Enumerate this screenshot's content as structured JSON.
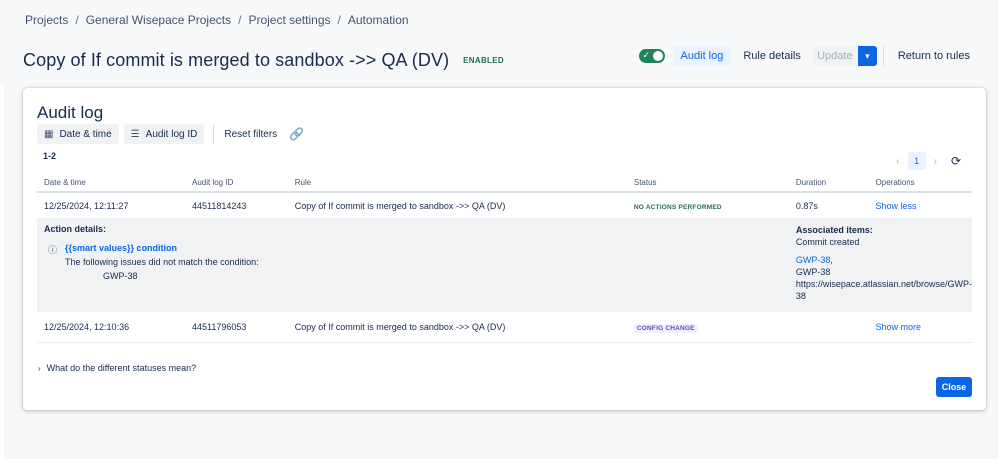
{
  "breadcrumb": [
    "Projects",
    "General Wisepace Projects",
    "Project settings",
    "Automation"
  ],
  "header": {
    "title": "Copy of If commit is merged to sandbox ->> QA (DV)",
    "status_lozenge": "ENABLED",
    "toggle_check": "✓",
    "audit_log_label": "Audit log",
    "rule_details_label": "Rule details",
    "update_label": "Update",
    "dropdown_icon": "▾",
    "return_label": "Return to rules"
  },
  "modal": {
    "title": "Audit log",
    "filters": {
      "date_time_label": "Date & time",
      "audit_id_label": "Audit log ID",
      "reset_label": "Reset filters",
      "calendar_icon": "▦",
      "list_icon": "☰",
      "link_icon": "🔗"
    },
    "count_label": "1-2",
    "pager": {
      "prev": "‹",
      "current_page": "1",
      "next": "›",
      "refresh": "⟳"
    },
    "columns": [
      "Date & time",
      "Audit log ID",
      "Rule",
      "Status",
      "Duration",
      "Operations"
    ],
    "rows": [
      {
        "date": "12/25/2024, 12:11:27",
        "id": "44511814243",
        "rule": "Copy of If commit is merged to sandbox ->> QA (DV)",
        "status": "NO ACTIONS PERFORMED",
        "duration": "0.87s",
        "operation": "Show less"
      },
      {
        "date": "12/25/2024, 12:10:36",
        "id": "44511796053",
        "rule": "Copy of If commit is merged to sandbox ->> QA (DV)",
        "status": "CONFIG CHANGE",
        "duration": "",
        "operation": "Show more"
      }
    ],
    "details": {
      "label": "Action details:",
      "info_icon": "ⓘ",
      "condition_title": "{{smart values}} condition",
      "condition_text": "The following issues did not match the condition:",
      "condition_issue": "GWP-38",
      "assoc_title": "Associated items:",
      "assoc_subtitle": "Commit created",
      "assoc_link": "GWP-38",
      "assoc_line1": "GWP-38",
      "assoc_line2": "https://wisepace.atlassian.net/browse/GWP-",
      "assoc_line3": "38"
    },
    "faq_chevron": "›",
    "faq_label": "What do the different statuses mean?",
    "close_label": "Close"
  },
  "colors": {
    "accent": "#0c66e4",
    "success": "#1f845a",
    "discovery": "#5e4db2"
  }
}
